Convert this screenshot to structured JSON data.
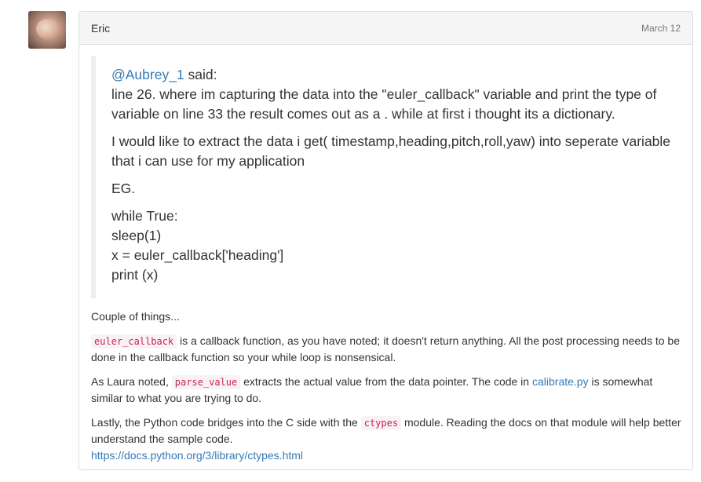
{
  "post": {
    "author": "Eric",
    "date": "March 12"
  },
  "quote": {
    "mention": "@Aubrey_1",
    "said": " said:",
    "line1": "line 26. where im capturing the data into the \"euler_callback\" variable and print the type of variable on line 33 the result comes out as a . while at first i thought its a dictionary.",
    "line2": "I would like to extract the data i get( timestamp,heading,pitch,roll,yaw) into seperate variable that i can use for my application",
    "line3": "EG.",
    "code_lines": [
      "while True:",
      "sleep(1)",
      "x = euler_callback['heading']",
      "print (x)"
    ]
  },
  "body": {
    "intro": "Couple of things...",
    "p1_code": "euler_callback",
    "p1_text": " is a callback function, as you have noted; it doesn't return anything. All the post processing needs to be done in the callback function so your while loop is nonsensical.",
    "p2_pre": "As Laura noted, ",
    "p2_code": "parse_value",
    "p2_mid": " extracts the actual value from the data pointer. The code in ",
    "p2_link": "calibrate.py",
    "p2_post": " is somewhat similar to what you are trying to do.",
    "p3_pre": "Lastly, the Python code bridges into the C side with the ",
    "p3_code": "ctypes",
    "p3_post": " module. Reading the docs on that module will help better understand the sample code.",
    "p3_link": "https://docs.python.org/3/library/ctypes.html"
  }
}
